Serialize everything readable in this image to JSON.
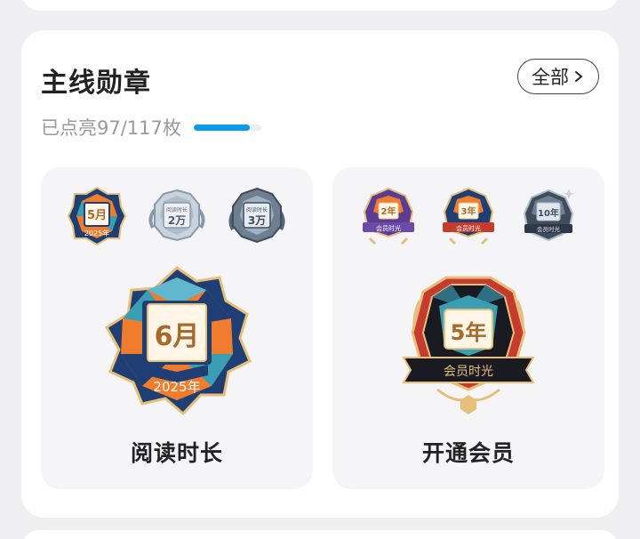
{
  "header": {
    "title": "主线勋章",
    "view_all_label": "全部"
  },
  "progress": {
    "text": "已点亮97/117枚",
    "lit": 97,
    "total": 117,
    "fraction": 0.829
  },
  "panels": [
    {
      "label": "阅读时长",
      "small_badges": [
        {
          "top": "5月",
          "bottom": "2025年"
        },
        {
          "top": "阅读时长",
          "bottom": "2万"
        },
        {
          "top": "阅读时长",
          "bottom": "3万"
        }
      ],
      "big_badge": {
        "top": "6月",
        "bottom": "2025年"
      }
    },
    {
      "label": "开通会员",
      "small_badges": [
        {
          "top": "2年",
          "bottom": "会员时光"
        },
        {
          "top": "3年",
          "bottom": "会员时光"
        },
        {
          "top": "10年",
          "bottom": "会员时光"
        }
      ],
      "big_badge": {
        "top": "5年",
        "bottom": "会员时光"
      }
    }
  ],
  "colors": {
    "accent": "#0b9ce8",
    "orange": "#f07d2e",
    "teal": "#3a9fb5",
    "navy": "#1f3f74",
    "gold": "#e6c07a",
    "silver": "#aebccb",
    "dark_silver": "#6f7f92",
    "purple": "#5a3d93",
    "red": "#c53b2e"
  },
  "icons": {
    "view_all": "chevron-right-icon"
  }
}
